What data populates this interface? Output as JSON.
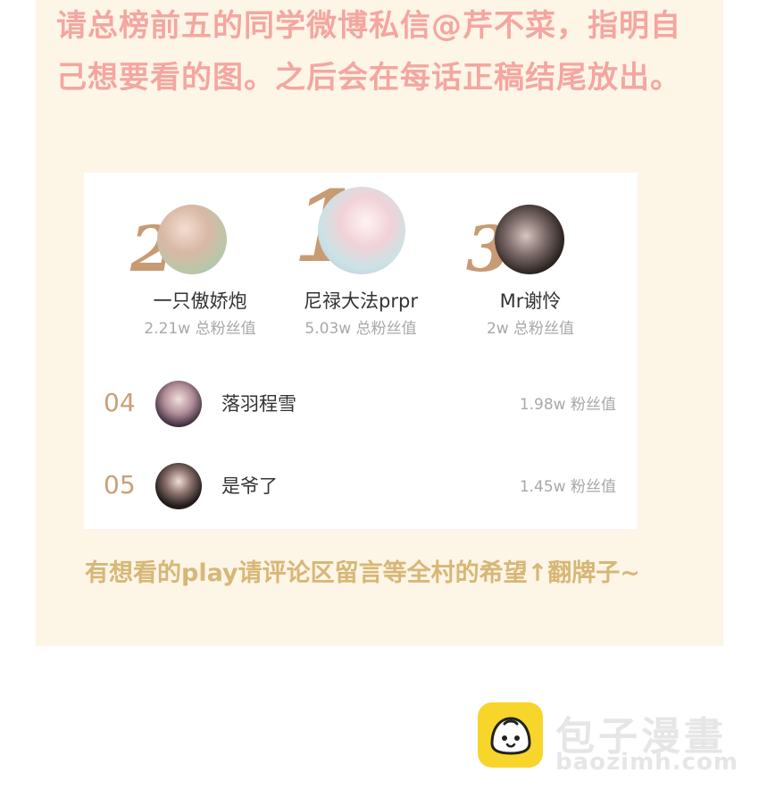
{
  "intro_text": "请总榜前五的同学微博私信@芹不菜，指明自己想要看的图。之后会在每话正稿结尾放出。",
  "ranking": {
    "top3": [
      {
        "rank": "2",
        "name": "一只傲娇炮",
        "value": "2.21w 总粉丝值"
      },
      {
        "rank": "1",
        "name": "尼禄大法prpr",
        "value": "5.03w 总粉丝值"
      },
      {
        "rank": "3",
        "name": "Mr谢怜",
        "value": "2w 总粉丝值"
      }
    ],
    "others": [
      {
        "rank": "04",
        "name": "落羽程雪",
        "value": "1.98w 粉丝值"
      },
      {
        "rank": "05",
        "name": "是爷了",
        "value": "1.45w 粉丝值"
      }
    ]
  },
  "footer_text": "有想看的play请评论区留言等全村的希望↑翻牌子~",
  "watermark": {
    "name": "包子漫畫",
    "url": "baozimh.com"
  },
  "colors": {
    "intro": "#f4a6a0",
    "rank_number": "#c79b74",
    "footer": "#d7b777",
    "panel_bg": "#fdf5e6",
    "logo_yellow": "#f8d52b"
  }
}
